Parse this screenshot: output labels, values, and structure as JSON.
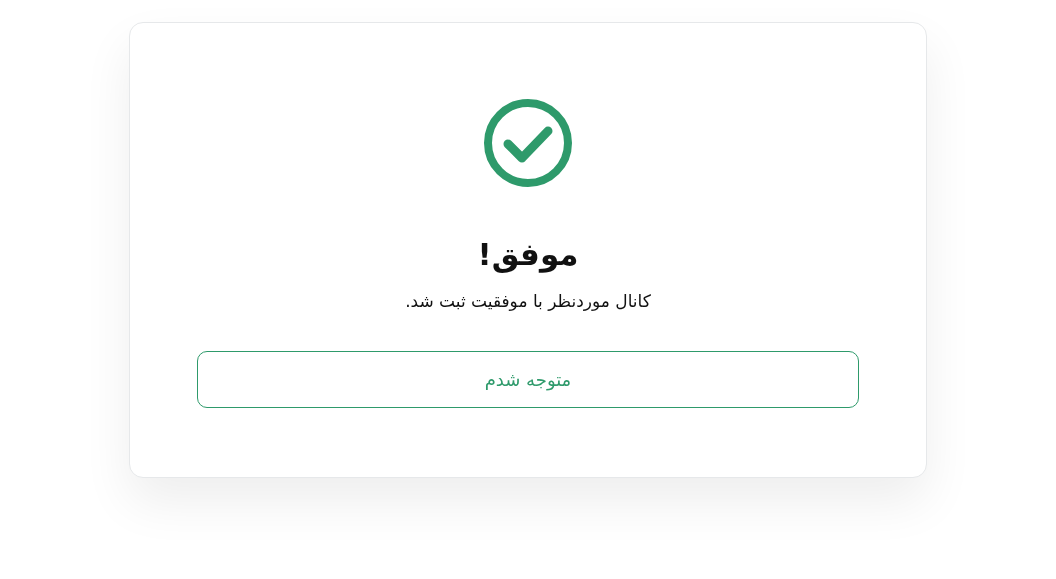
{
  "dialog": {
    "title": "موفق!",
    "message": "کانال موردنظر با موفقیت ثبت شد.",
    "button": "متوجه شدم"
  }
}
